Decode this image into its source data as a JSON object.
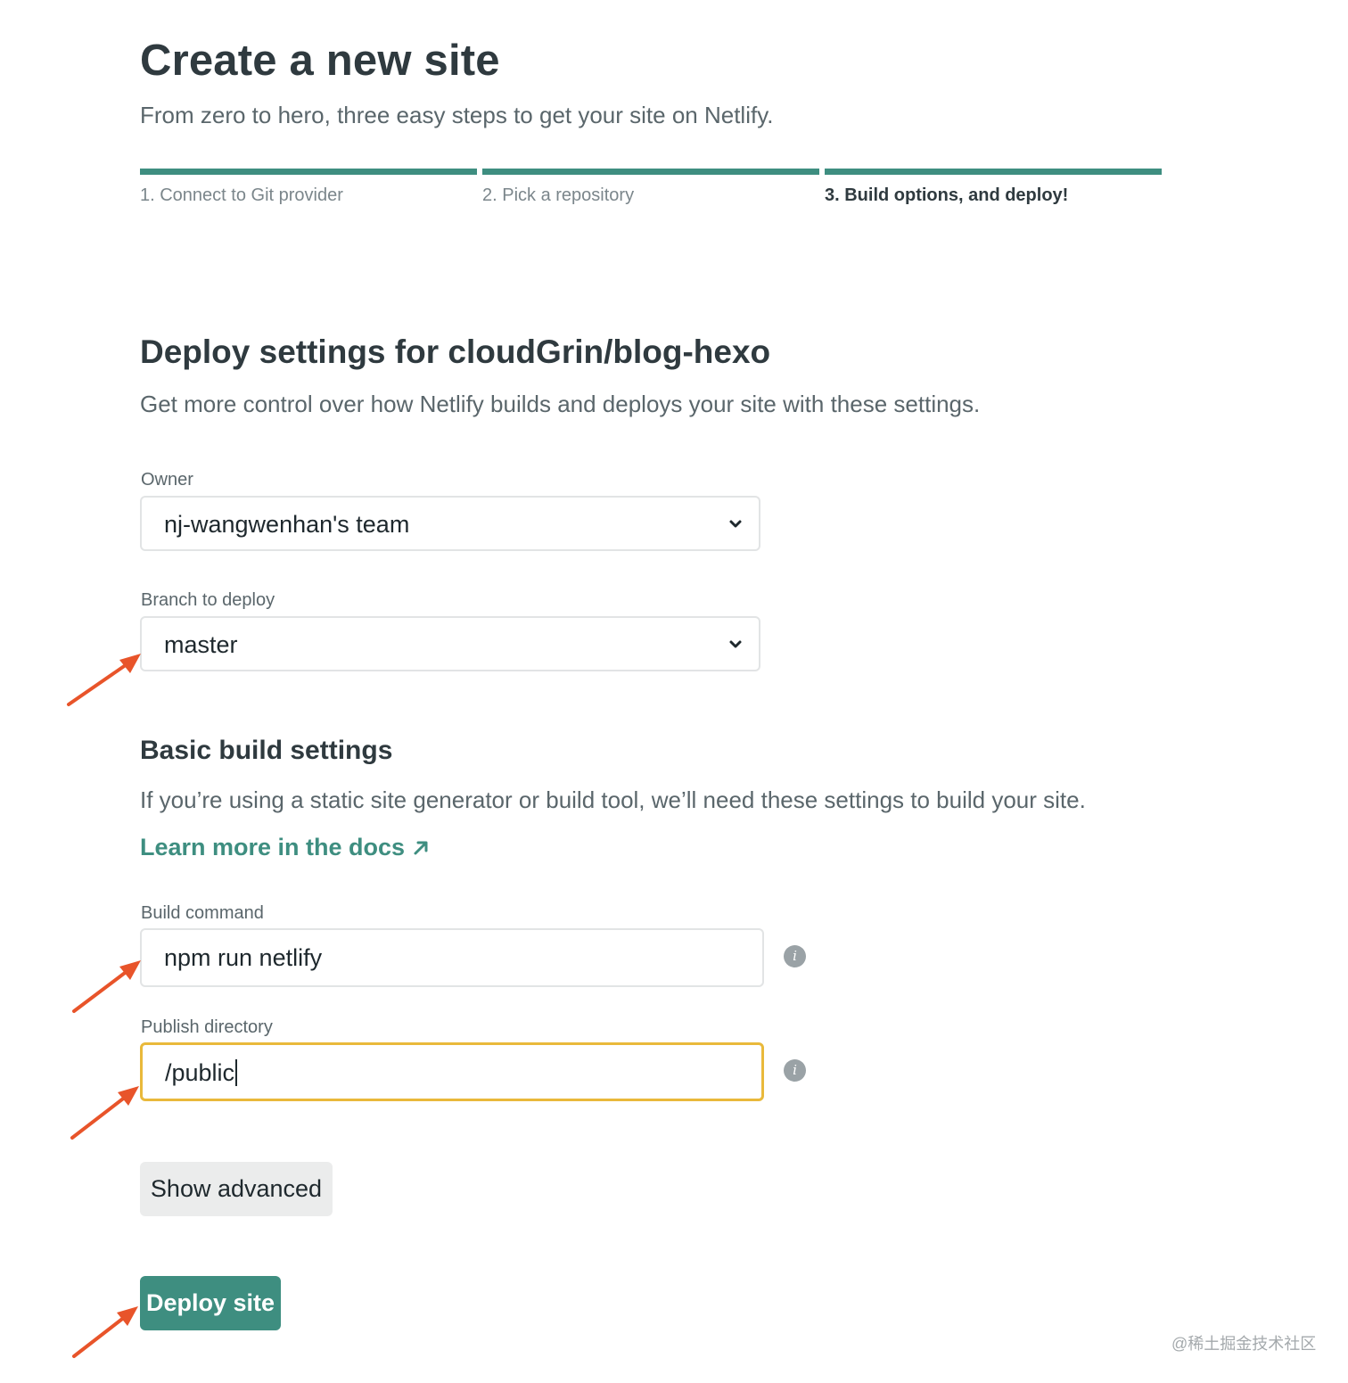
{
  "header": {
    "title": "Create a new site",
    "subtitle": "From zero to hero, three easy steps to get your site on Netlify."
  },
  "steps": [
    {
      "label": "1. Connect to Git provider",
      "active": false
    },
    {
      "label": "2. Pick a repository",
      "active": false
    },
    {
      "label": "3. Build options, and deploy!",
      "active": true
    }
  ],
  "deploy_settings": {
    "title": "Deploy settings for cloudGrin/blog-hexo",
    "description": "Get more control over how Netlify builds and deploys your site with these settings."
  },
  "owner": {
    "label": "Owner",
    "selected": "nj-wangwenhan's team"
  },
  "branch": {
    "label": "Branch to deploy",
    "selected": "master"
  },
  "basic_build": {
    "title": "Basic build settings",
    "description": "If you’re using a static site generator or build tool, we’ll need these settings to build your site.",
    "docs_link": "Learn more in the docs"
  },
  "build_command": {
    "label": "Build command",
    "value": "npm run netlify"
  },
  "publish_directory": {
    "label": "Publish directory",
    "value": "/public"
  },
  "buttons": {
    "show_advanced": "Show advanced",
    "deploy": "Deploy site"
  },
  "watermark": "@稀土掘金技术社区",
  "colors": {
    "accent": "#3e8e80",
    "focus_border": "#e9b93b",
    "annotation_arrow": "#e8542a"
  },
  "icons": {
    "dropdown": "chevron-down-icon",
    "info": "info-icon",
    "external_link": "arrow-up-right-icon",
    "annotation": "red-arrow-icon"
  }
}
